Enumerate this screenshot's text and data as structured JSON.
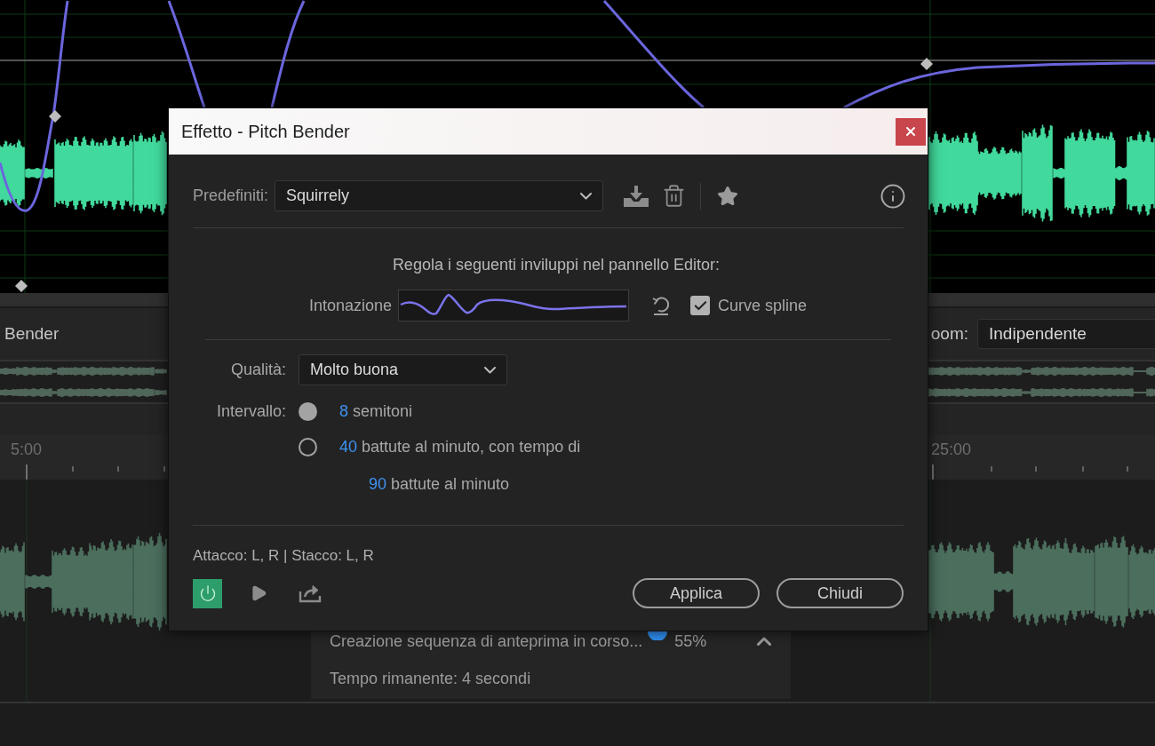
{
  "editor": {
    "effect_name": "Bender",
    "zoom": {
      "label": "oom:",
      "value": "Indipendente"
    },
    "timeline": [
      "5:00",
      "25:00"
    ],
    "progress": {
      "message": "Creazione sequenza di anteprima in corso...",
      "percent": "55%",
      "remaining": "Tempo rimanente: 4 secondi"
    }
  },
  "dialog": {
    "title": "Effetto - Pitch Bender",
    "presets": {
      "label": "Predefiniti:",
      "value": "Squirrely"
    },
    "instruction": "Regola i seguenti inviluppi nel pannello Editor:",
    "envelope": {
      "label": "Intonazione"
    },
    "spline": {
      "label": "Curve spline",
      "checked": true
    },
    "quality": {
      "label": "Qualità:",
      "value": "Molto buona"
    },
    "range": {
      "label": "Intervallo:",
      "options": [
        {
          "value": "8",
          "unit": "semitoni",
          "selected": true
        },
        {
          "value": "40",
          "unit": "battute al minuto, con tempo di",
          "selected": false,
          "tempo": {
            "value": "90",
            "unit": "battute al minuto"
          }
        }
      ]
    },
    "channels": "Attacco: L, R | Stacco: L, R",
    "power": {
      "on": true
    },
    "buttons": [
      "Applica",
      "Chiudi"
    ]
  }
}
